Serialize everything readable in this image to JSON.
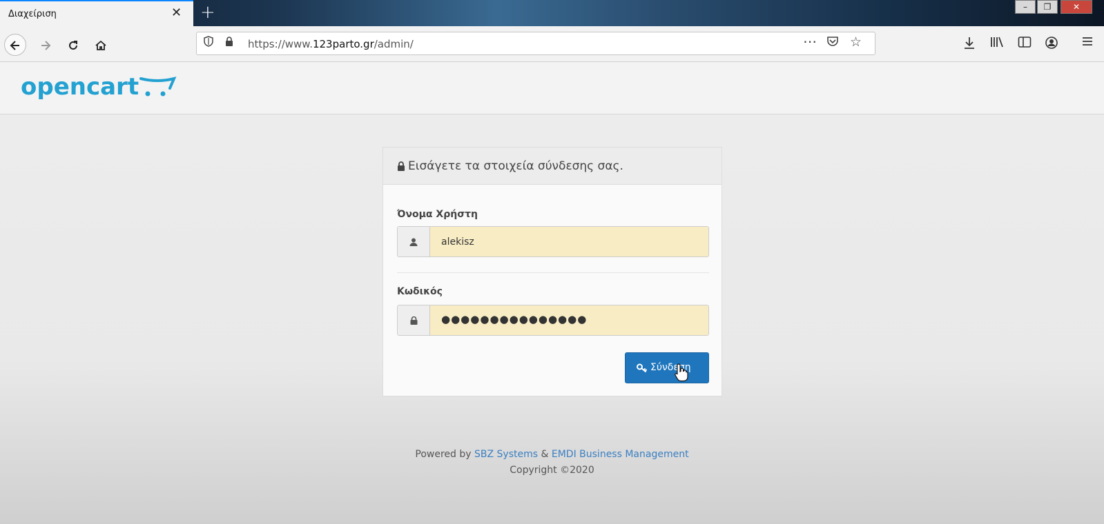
{
  "browser": {
    "tab_title": "Διαχείριση",
    "tab_close": "✕",
    "new_tab": "+",
    "url_scheme": "https://www.",
    "url_host": "123parto.gr",
    "url_path": "/admin/",
    "window_controls": [
      "–",
      "❐",
      "✕"
    ]
  },
  "header": {
    "logo_text": "opencart"
  },
  "login": {
    "heading": "Εισάγετε τα στοιχεία σύνδεσης σας.",
    "username_label": "Όνομα Χρήστη",
    "username_value": "alekisz",
    "password_label": "Κωδικός",
    "password_mask": "●●●●●●●●●●●●●●●",
    "submit_label": "Σύνδεση"
  },
  "footer": {
    "powered_prefix": "Powered by ",
    "link1": "SBZ Systems",
    "amp": " & ",
    "link2": "EMDI Business Management",
    "copyright": "Copyright ©2020"
  },
  "colors": {
    "brand": "#23a1d1",
    "button": "#1f76bd",
    "autofill": "#f8ecc4",
    "link": "#3a7fc1"
  },
  "icons": [
    "back-arrow-icon",
    "forward-arrow-icon",
    "reload-icon",
    "home-icon",
    "shield-icon",
    "lock-icon",
    "more-icon",
    "pocket-icon",
    "star-icon",
    "download-icon",
    "library-icon",
    "sidebar-icon",
    "account-icon",
    "menu-icon",
    "user-icon",
    "key-icon",
    "hand-cursor-icon"
  ]
}
